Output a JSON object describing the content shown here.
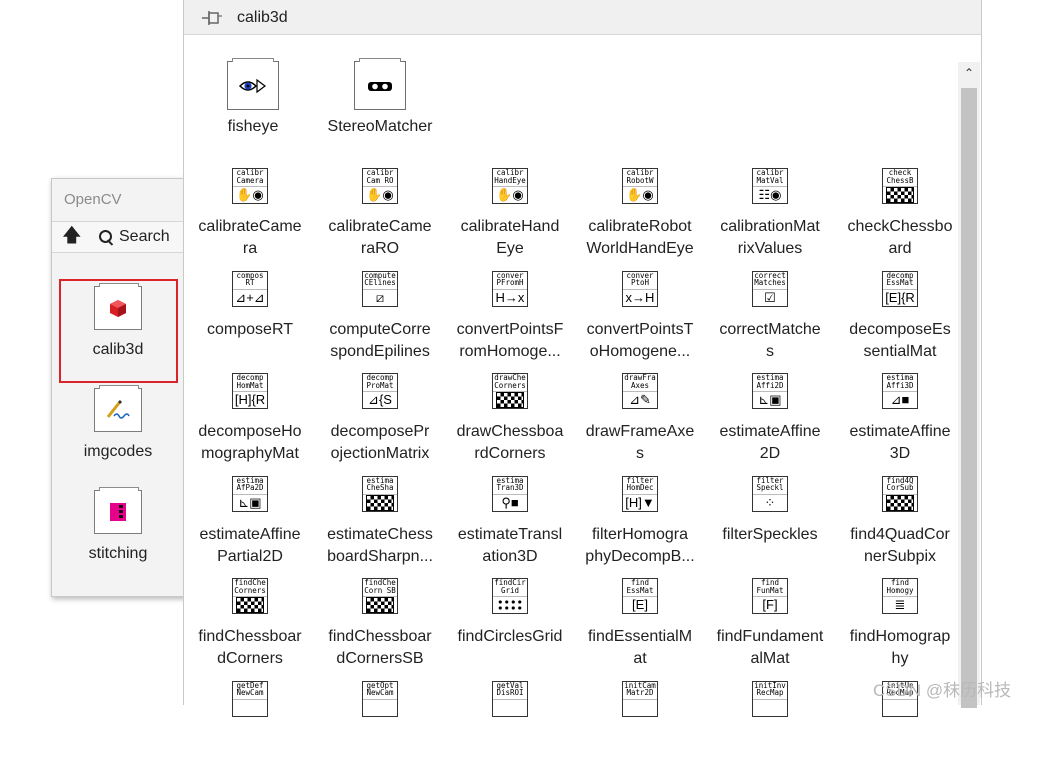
{
  "side_palette": {
    "title": "OpenCV",
    "search_label": "Search",
    "items": [
      {
        "label": "calib3d",
        "icon": "cube-icon",
        "selected": true
      },
      {
        "label": "imgcodes",
        "icon": "pen-write-icon",
        "selected": false
      },
      {
        "label": "stitching",
        "icon": "stitch-icon",
        "selected": false
      }
    ]
  },
  "window": {
    "title": "calib3d",
    "subpalettes": [
      {
        "label": "fisheye",
        "icon": "eye-icon"
      },
      {
        "label": "StereoMatcher",
        "icon": "glasses-icon"
      }
    ],
    "vis": [
      {
        "label": [
          "calibrateCame",
          "ra"
        ],
        "icon_text": [
          "calibr",
          "Camera"
        ],
        "glyph": "✋◉"
      },
      {
        "label": [
          "calibrateCame",
          "raRO"
        ],
        "icon_text": [
          "calibr",
          "Cam RO"
        ],
        "glyph": "✋◉"
      },
      {
        "label": [
          "calibrateHand",
          "Eye"
        ],
        "icon_text": [
          "calibr",
          "HandEye"
        ],
        "glyph": "✋◉"
      },
      {
        "label": [
          "calibrateRobot",
          "WorldHandEye"
        ],
        "icon_text": [
          "calibr",
          "RobotW"
        ],
        "glyph": "✋◉"
      },
      {
        "label": [
          "calibrationMat",
          "rixValues"
        ],
        "icon_text": [
          "calibr",
          "MatVal"
        ],
        "glyph": "☷◉"
      },
      {
        "label": [
          "checkChessbo",
          "ard"
        ],
        "icon_text": [
          "check",
          "ChessB"
        ],
        "glyph": "checker"
      },
      {
        "label": [
          "composeRT"
        ],
        "icon_text": [
          "compos",
          "RT"
        ],
        "glyph": "⊿+⊿"
      },
      {
        "label": [
          "computeCorre",
          "spondEpilines"
        ],
        "icon_text": [
          "compute",
          "CElines"
        ],
        "glyph": "⧄"
      },
      {
        "label": [
          "convertPointsF",
          "romHomoge..."
        ],
        "icon_text": [
          "conver",
          "PFromH"
        ],
        "glyph": "H→x"
      },
      {
        "label": [
          "convertPointsT",
          "oHomogene..."
        ],
        "icon_text": [
          "conver",
          "PtoH"
        ],
        "glyph": "x→H"
      },
      {
        "label": [
          "correctMatche",
          "s"
        ],
        "icon_text": [
          "correct",
          "Matches"
        ],
        "glyph": "☑"
      },
      {
        "label": [
          "decomposeEs",
          "sentialMat"
        ],
        "icon_text": [
          "decomp",
          "EssMat"
        ],
        "glyph": "[E]{R"
      },
      {
        "label": [
          "decomposeHo",
          "mographyMat"
        ],
        "icon_text": [
          "decomp",
          "HomMat"
        ],
        "glyph": "[H]{R"
      },
      {
        "label": [
          "decomposePr",
          "ojectionMatrix"
        ],
        "icon_text": [
          "decomp",
          "ProMat"
        ],
        "glyph": "⊿{S"
      },
      {
        "label": [
          "drawChessboa",
          "rdCorners"
        ],
        "icon_text": [
          "drawChe",
          "Corners"
        ],
        "glyph": "checker"
      },
      {
        "label": [
          "drawFrameAxe",
          "s"
        ],
        "icon_text": [
          "drawFra",
          "Axes"
        ],
        "glyph": "⊿✎"
      },
      {
        "label": [
          "estimateAffine",
          "2D"
        ],
        "icon_text": [
          "estima",
          "Affi2D"
        ],
        "glyph": "⊾▣"
      },
      {
        "label": [
          "estimateAffine",
          "3D"
        ],
        "icon_text": [
          "estima",
          "Affi3D"
        ],
        "glyph": "⊿■"
      },
      {
        "label": [
          "estimateAffine",
          "Partial2D"
        ],
        "icon_text": [
          "estima",
          "AfPa2D"
        ],
        "glyph": "⊾▣"
      },
      {
        "label": [
          "estimateChess",
          "boardSharpn..."
        ],
        "icon_text": [
          "estima",
          "CheSha"
        ],
        "glyph": "checker"
      },
      {
        "label": [
          "estimateTransl",
          "ation3D"
        ],
        "icon_text": [
          "estima",
          "Tran3D"
        ],
        "glyph": "⚲■"
      },
      {
        "label": [
          "filterHomogra",
          "phyDecompB..."
        ],
        "icon_text": [
          "filter",
          "HomDec"
        ],
        "glyph": "[H]▼"
      },
      {
        "label": [
          "filterSpeckles"
        ],
        "icon_text": [
          "filter",
          "Speckl"
        ],
        "glyph": "⁘"
      },
      {
        "label": [
          "find4QuadCor",
          "nerSubpix"
        ],
        "icon_text": [
          "find4Q",
          "CorSub"
        ],
        "glyph": "checker"
      },
      {
        "label": [
          "findChessboar",
          "dCorners"
        ],
        "icon_text": [
          "findChe",
          "Corners"
        ],
        "glyph": "checker"
      },
      {
        "label": [
          "findChessboar",
          "dCornersSB"
        ],
        "icon_text": [
          "findChe",
          "Corn SB"
        ],
        "glyph": "checker"
      },
      {
        "label": [
          "findCirclesGrid"
        ],
        "icon_text": [
          "findCir",
          "Grid"
        ],
        "glyph": "dots"
      },
      {
        "label": [
          "findEssentialM",
          "at"
        ],
        "icon_text": [
          "find",
          "EssMat"
        ],
        "glyph": "[E]"
      },
      {
        "label": [
          "findFundament",
          "alMat"
        ],
        "icon_text": [
          "find",
          "FunMat"
        ],
        "glyph": "[F]"
      },
      {
        "label": [
          "findHomograp",
          "hy"
        ],
        "icon_text": [
          "find",
          "Homogy"
        ],
        "glyph": "≣"
      },
      {
        "label": [
          ""
        ],
        "icon_text": [
          "getDef",
          "NewCam"
        ],
        "glyph": ""
      },
      {
        "label": [
          ""
        ],
        "icon_text": [
          "getOpt",
          "NewCam"
        ],
        "glyph": ""
      },
      {
        "label": [
          ""
        ],
        "icon_text": [
          "getVal",
          "DisROI"
        ],
        "glyph": ""
      },
      {
        "label": [
          ""
        ],
        "icon_text": [
          "initCam",
          "Matr2D"
        ],
        "glyph": ""
      },
      {
        "label": [
          ""
        ],
        "icon_text": [
          "initInv",
          "RecMap"
        ],
        "glyph": ""
      },
      {
        "label": [
          ""
        ],
        "icon_text": [
          "initUn",
          "RecMap"
        ],
        "glyph": ""
      }
    ]
  },
  "watermark": "CSDN @秣历科技",
  "colors": {
    "selection_border": "#d9242a",
    "scroll_thumb": "#c3c3c3"
  }
}
